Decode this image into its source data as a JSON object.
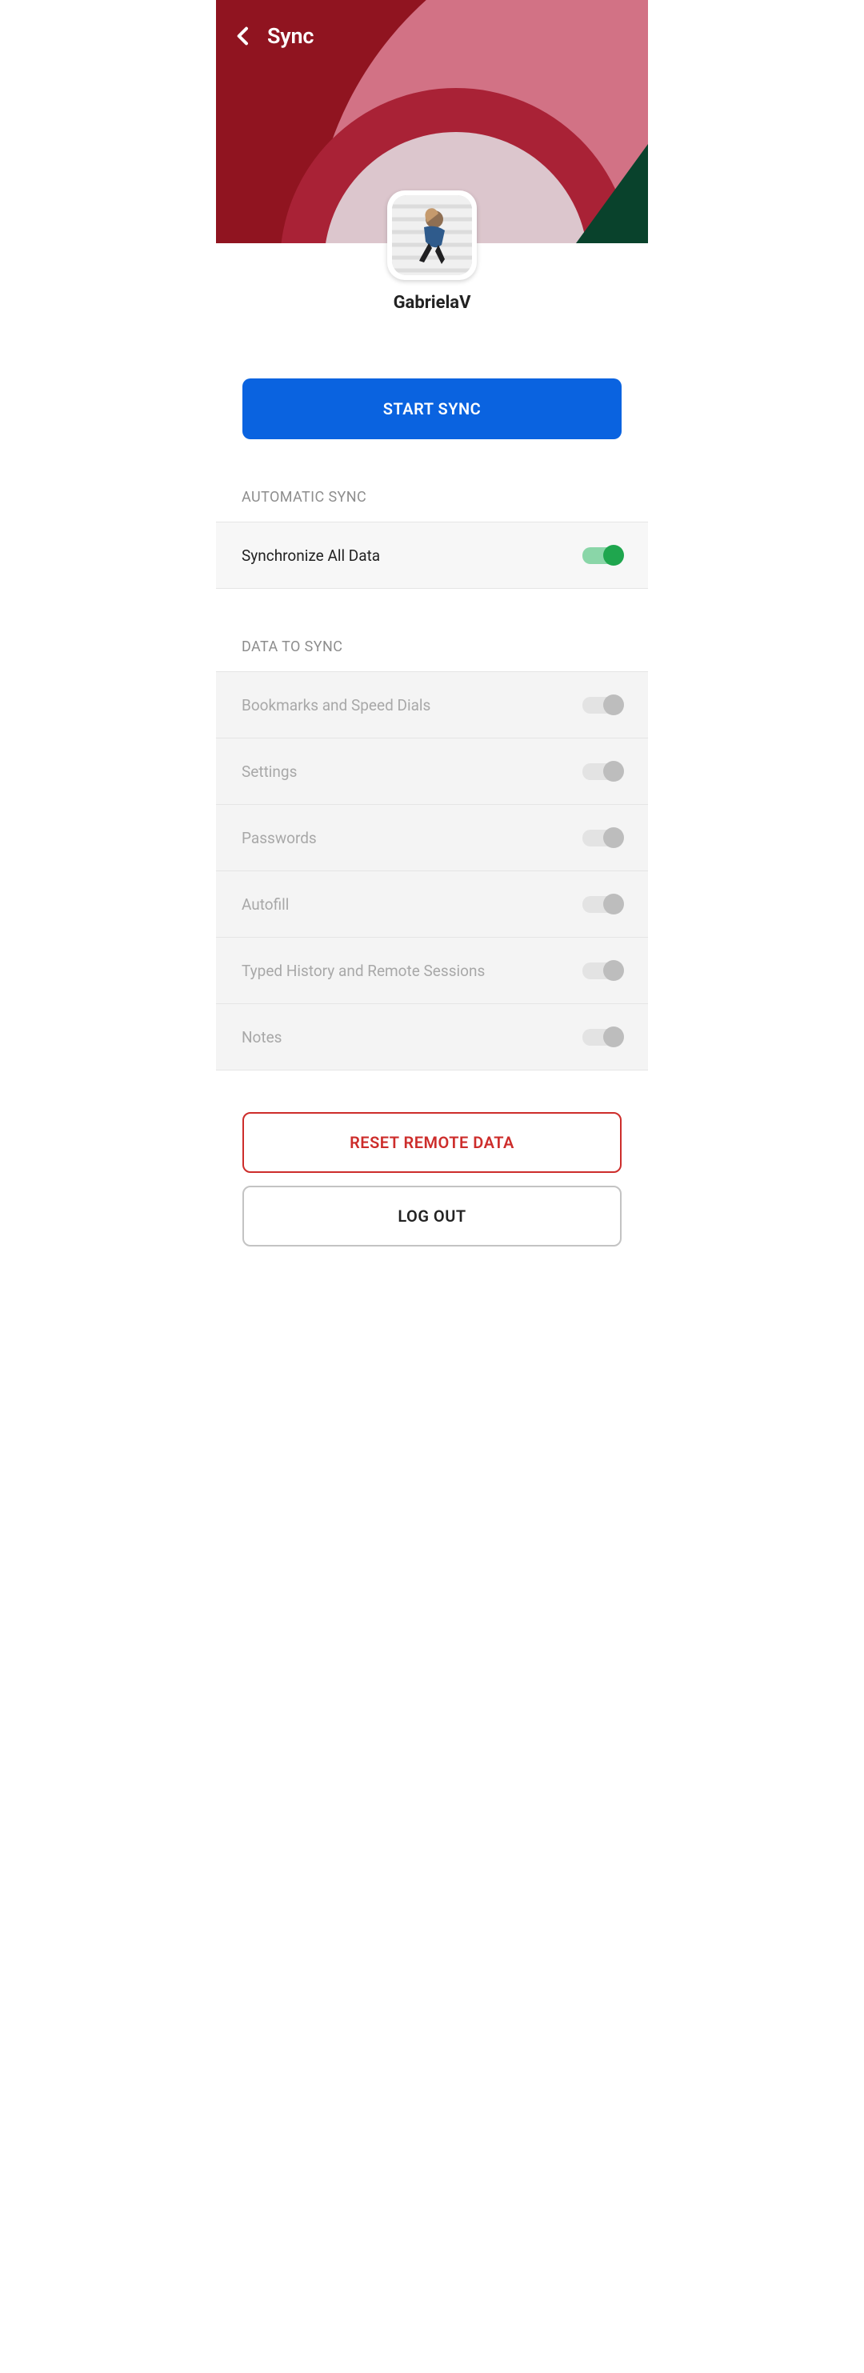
{
  "appbar": {
    "title": "Sync"
  },
  "user": {
    "name": "GabrielaV"
  },
  "buttons": {
    "start_sync": "START SYNC",
    "reset_remote": "RESET REMOTE DATA",
    "log_out": "LOG OUT"
  },
  "sections": {
    "automatic_sync": {
      "header": "AUTOMATIC SYNC",
      "sync_all_label": "Synchronize All Data",
      "sync_all_on": true
    },
    "data_to_sync": {
      "header": "DATA TO SYNC",
      "items": [
        {
          "label": "Bookmarks and Speed Dials",
          "on": false,
          "disabled": true
        },
        {
          "label": "Settings",
          "on": false,
          "disabled": true
        },
        {
          "label": "Passwords",
          "on": false,
          "disabled": true
        },
        {
          "label": "Autofill",
          "on": false,
          "disabled": true
        },
        {
          "label": "Typed History and Remote Sessions",
          "on": false,
          "disabled": true
        },
        {
          "label": "Notes",
          "on": false,
          "disabled": true
        }
      ]
    }
  },
  "colors": {
    "primary_blue": "#0a63e0",
    "danger_red": "#cd2d2b",
    "switch_on": "#1fa64e"
  }
}
